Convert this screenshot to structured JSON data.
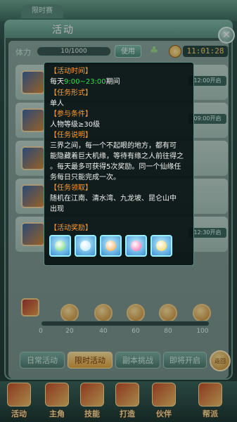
{
  "top_tab": {
    "label": "限时赛"
  },
  "panel": {
    "title": "活动",
    "close_icon": "close-icon"
  },
  "stamina": {
    "label": "体力",
    "value": "10/1000",
    "use_label": "使用"
  },
  "timer": {
    "icon": "clock-icon",
    "value": "11:01:28"
  },
  "activity_rows": [
    {
      "time": "12:00开启"
    },
    {
      "time": "09:00开启"
    },
    {
      "time": ""
    },
    {
      "time": ""
    },
    {
      "time": "12:30开启"
    }
  ],
  "progress": {
    "ticks": [
      "0",
      "20",
      "40",
      "60",
      "80",
      "100"
    ],
    "value_fraction": 0.0
  },
  "tabs": [
    {
      "label": "日常活动"
    },
    {
      "label": "限时活动"
    },
    {
      "label": "副本挑战"
    },
    {
      "label": "即将开启"
    }
  ],
  "back": {
    "label": "返回"
  },
  "nav": [
    {
      "label": "活动"
    },
    {
      "label": "主角"
    },
    {
      "label": "技能"
    },
    {
      "label": "打造"
    },
    {
      "label": "伙伴"
    },
    {
      "label": "帮派"
    }
  ],
  "tooltip": {
    "time_header": "【活动时间】",
    "time_prefix": "每天",
    "time_value": "9:00~23:00",
    "time_suffix": "期间",
    "form_header": "【任务形式】",
    "form_value": "单人",
    "cond_header": "【参与条件】",
    "cond_value": "人物等级≥30级",
    "desc_header": "【任务说明】",
    "desc_lines": [
      "三界之间，每一个不起眼的地方，都有可",
      "能隐藏着巨大机缘，等待有缘之人前往得之",
      "。每天最多可获得5次奖励。同一个仙缘任",
      "务每日只能完成一次。"
    ],
    "receive_header": "【任务领取】",
    "receive_lines": [
      "随机在江南、清水湾、九龙坡、昆仑山中",
      "出现"
    ],
    "reward_header": "【活动奖励】",
    "rewards": [
      {
        "icon": "green-gem-icon",
        "color": "#5fd86a"
      },
      {
        "icon": "blue-crystal-icon",
        "color": "#b9e8ff"
      },
      {
        "icon": "golden-horn-icon",
        "color": "#f2a640"
      },
      {
        "icon": "pink-orb-icon",
        "color": "#ff5fa8"
      },
      {
        "icon": "gold-nugget-icon",
        "color": "#f7d04a"
      }
    ]
  }
}
